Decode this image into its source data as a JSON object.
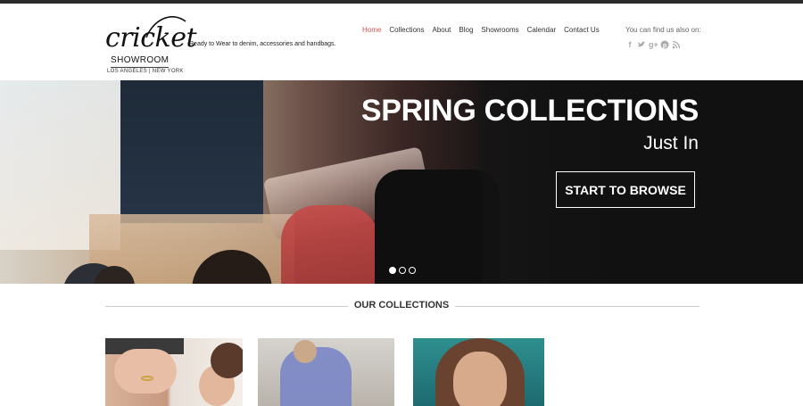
{
  "brand": {
    "script_name": "cricket",
    "showroom": "SHOWROOM",
    "cities": "LOS ANGELES | NEW YORK",
    "tagline": "Ready to Wear to denim, accessories and handbags."
  },
  "nav": {
    "items": [
      {
        "label": "Home",
        "active": true
      },
      {
        "label": "Collections"
      },
      {
        "label": "About"
      },
      {
        "label": "Blog"
      },
      {
        "label": "Showrooms"
      },
      {
        "label": "Calendar"
      },
      {
        "label": "Contact Us"
      }
    ]
  },
  "social": {
    "label": "You can find us also on:",
    "icons": [
      "facebook-icon",
      "twitter-icon",
      "google-plus-icon",
      "pinterest-icon",
      "rss-icon"
    ]
  },
  "hero": {
    "title": "SPRING COLLECTIONS",
    "subtitle": "Just In",
    "button_label": "START TO BROWSE",
    "slides": 3,
    "active_slide": 1
  },
  "collections": {
    "title": "OUR COLLECTIONS",
    "items": [
      {
        "image": "jewelry-photo"
      },
      {
        "image": "beach-dress-photo"
      },
      {
        "image": "portrait-photo"
      }
    ]
  },
  "colors": {
    "accent": "#d9534f",
    "top_bar": "#2b2b2b"
  }
}
